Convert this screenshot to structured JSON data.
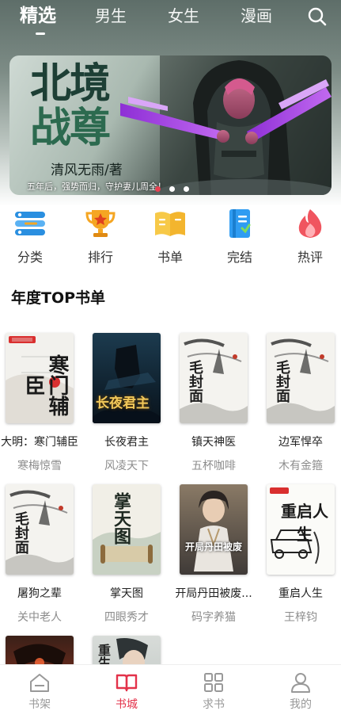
{
  "top_tabs": [
    {
      "label": "精选",
      "active": true
    },
    {
      "label": "男生",
      "active": false
    },
    {
      "label": "女生",
      "active": false
    },
    {
      "label": "漫画",
      "active": false
    }
  ],
  "banner": {
    "title_line1": "北境",
    "title_line2": "战尊",
    "author": "清风无雨/著",
    "description": "五年后，强势而归，守护妻儿周全！",
    "slide_count": 3,
    "active_slide": 1
  },
  "categories": [
    {
      "label": "分类",
      "icon": "list-icon",
      "color": "#2a8fe0"
    },
    {
      "label": "排行",
      "icon": "trophy-icon",
      "color": "#f5a623"
    },
    {
      "label": "书单",
      "icon": "book-icon",
      "color": "#f7c948"
    },
    {
      "label": "完结",
      "icon": "bookmark-icon",
      "color": "#2f9cf2"
    },
    {
      "label": "热评",
      "icon": "flame-icon",
      "color": "#f0555f"
    }
  ],
  "section": {
    "title": "年度TOP书单"
  },
  "books": [
    {
      "title": "大明：寒门辅臣",
      "author": "寒梅惊雪",
      "cover_text": "寒门辅臣"
    },
    {
      "title": "长夜君主",
      "author": "风凌天下",
      "cover_text": "长夜君主"
    },
    {
      "title": "镇天神医",
      "author": "五杯咖啡",
      "cover_text": "毛封面"
    },
    {
      "title": "边军悍卒",
      "author": "木有金箍",
      "cover_text": "毛封面"
    },
    {
      "title": "屠狗之辈",
      "author": "关中老人",
      "cover_text": "毛封面"
    },
    {
      "title": "掌天图",
      "author": "四眼秀才",
      "cover_text": "掌天图"
    },
    {
      "title": "开局丹田被废...",
      "author": "码字养猫",
      "cover_text": "开局丹田被废"
    },
    {
      "title": "重启人生",
      "author": "王梓钧",
      "cover_text": "重启人生"
    },
    {
      "title": "",
      "author": "",
      "cover_text": ""
    },
    {
      "title": "",
      "author": "",
      "cover_text": "重生"
    }
  ],
  "bottom_nav": [
    {
      "label": "书架",
      "icon": "bookshelf-icon",
      "active": false
    },
    {
      "label": "书城",
      "icon": "open-book-icon",
      "active": true
    },
    {
      "label": "求书",
      "icon": "grid-icon",
      "active": false
    },
    {
      "label": "我的",
      "icon": "user-icon",
      "active": false
    }
  ],
  "colors": {
    "accent": "#e3324a",
    "header_bg": "#6f7e79",
    "inactive_nav": "#999999"
  }
}
